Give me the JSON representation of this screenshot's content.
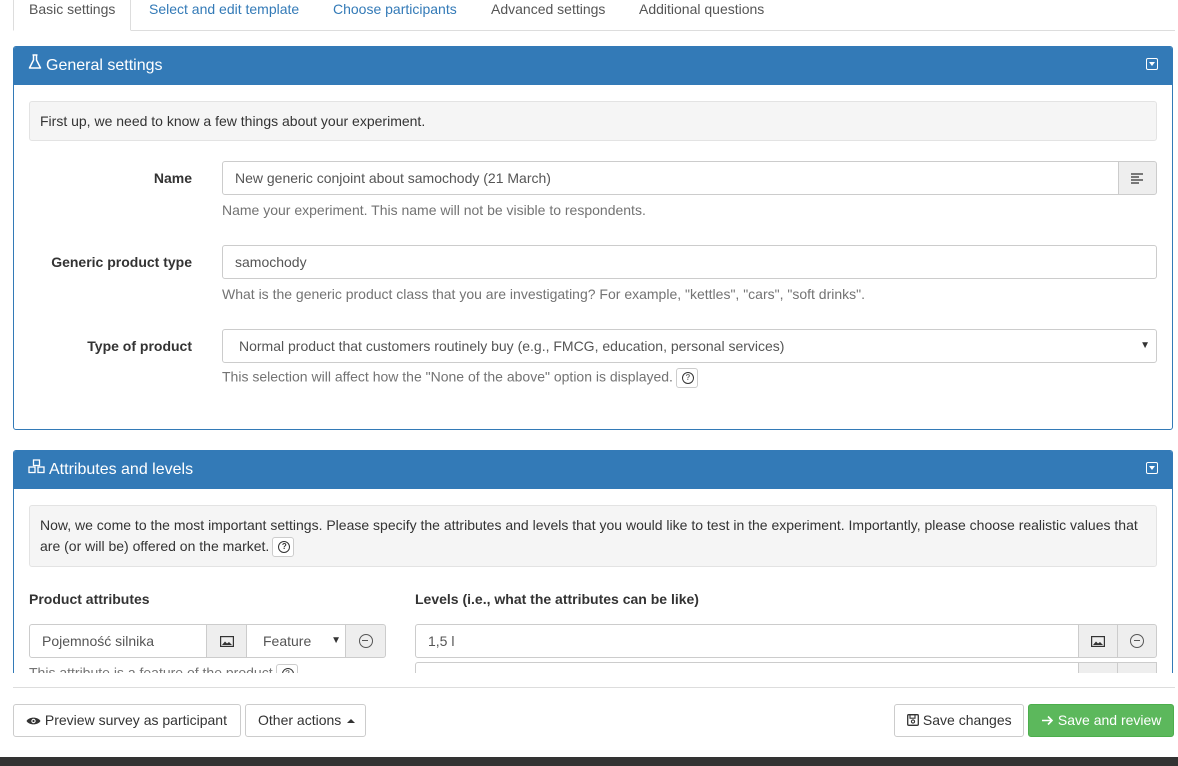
{
  "tabs": [
    {
      "label": "Basic settings",
      "active": true
    },
    {
      "label": "Select and edit template"
    },
    {
      "label": "Choose participants"
    },
    {
      "label": "Advanced settings"
    },
    {
      "label": "Additional questions"
    }
  ],
  "general": {
    "title": "General settings",
    "intro": "First up, we need to know a few things about your experiment.",
    "name_label": "Name",
    "name_value": "New generic conjoint about samochody (21 March)",
    "name_help": "Name your experiment. This name will not be visible to respondents.",
    "product_type_label": "Generic product type",
    "product_type_value": "samochody",
    "product_type_help": "What is the generic product class that you are investigating? For example, \"kettles\", \"cars\", \"soft drinks\".",
    "type_label": "Type of product",
    "type_value": "Normal product that customers routinely buy (e.g., FMCG, education, personal services)",
    "type_help": "This selection will affect how the \"None of the above\" option is displayed."
  },
  "attributes": {
    "title": "Attributes and levels",
    "intro": "Now, we come to the most important settings. Please specify the attributes and levels that you would like to test in the experiment. Importantly, please choose realistic values that are (or will be) offered on the market.",
    "product_attributes_heading": "Product attributes",
    "levels_heading": "Levels (i.e., what the attributes can be like)",
    "attribute_value": "Pojemność silnika",
    "attribute_kind": "Feature",
    "attribute_help": "This attribute is a feature of the product",
    "level_value": "1,5 l"
  },
  "footer": {
    "preview_label": "Preview survey as participant",
    "other_actions_label": "Other actions",
    "save_label": "Save changes",
    "save_review_label": "Save and review"
  },
  "colors": {
    "primary": "#337ab7",
    "success": "#5cb85c"
  }
}
